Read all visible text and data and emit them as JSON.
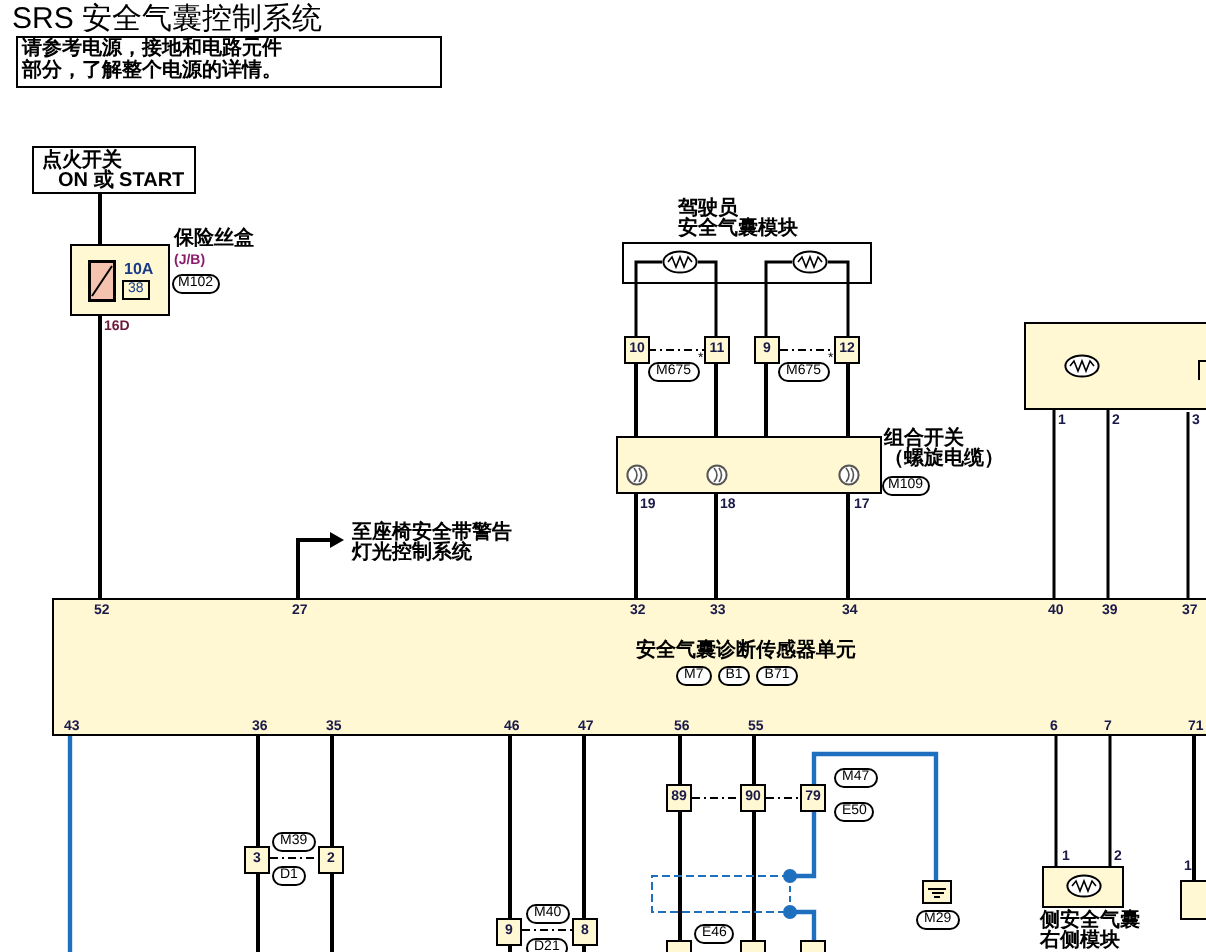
{
  "title": "SRS 安全气囊控制系统",
  "note": [
    "请参考电源，接地和电路元件",
    "部分，了解整个电源的详情。"
  ],
  "ignition_switch": [
    "点火开关",
    "ON 或 START"
  ],
  "fuse_block": {
    "label": "保险丝盒",
    "sublabel": "(J/B)",
    "rating": "10A",
    "fuse_number": "38",
    "connector": "M102",
    "pin": "16D"
  },
  "driver_airbag_module": {
    "label": [
      "驾驶员",
      "安全气囊模块"
    ]
  },
  "spiral_cable": {
    "label": [
      "组合开关",
      "（螺旋电缆）"
    ],
    "connector": "M109",
    "pins": [
      "19",
      "18",
      "17"
    ]
  },
  "right_module": {
    "pins": [
      "1",
      "2",
      "3"
    ]
  },
  "seatbelt_link": [
    "至座椅安全带警告",
    "灯光控制系统"
  ],
  "control_unit": {
    "label": "安全气囊诊断传感器单元",
    "connectors": [
      "M7",
      "B1",
      "B71"
    ],
    "top_pins": [
      "52",
      "27",
      "32",
      "33",
      "34",
      "40",
      "39",
      "37"
    ],
    "bottom_pins": [
      "43",
      "36",
      "35",
      "46",
      "47",
      "56",
      "55",
      "6",
      "7",
      "71"
    ]
  },
  "inline_connectors": [
    {
      "pin": "10"
    },
    {
      "pin": "11"
    },
    {
      "pin": "9"
    },
    {
      "pin": "12"
    },
    {
      "pin": "3"
    },
    {
      "pin": "2"
    },
    {
      "pin": "9"
    },
    {
      "pin": "8"
    },
    {
      "pin": "89"
    },
    {
      "pin": "90"
    },
    {
      "pin": "79"
    }
  ],
  "connector_tags": [
    {
      "text": "M675",
      "mark": "*"
    },
    {
      "text": "M675",
      "mark": "*"
    },
    {
      "text": "M39"
    },
    {
      "text": "D1"
    },
    {
      "text": "M40"
    },
    {
      "text": "D21"
    },
    {
      "text": "M47"
    },
    {
      "text": "E50"
    },
    {
      "text": "E46"
    },
    {
      "text": "M29"
    }
  ],
  "side_airbag_module": {
    "label": [
      "侧安全气囊",
      "右侧模块"
    ],
    "pins": [
      "1",
      "2"
    ]
  },
  "cut_module": {
    "pins": [
      "1"
    ]
  }
}
